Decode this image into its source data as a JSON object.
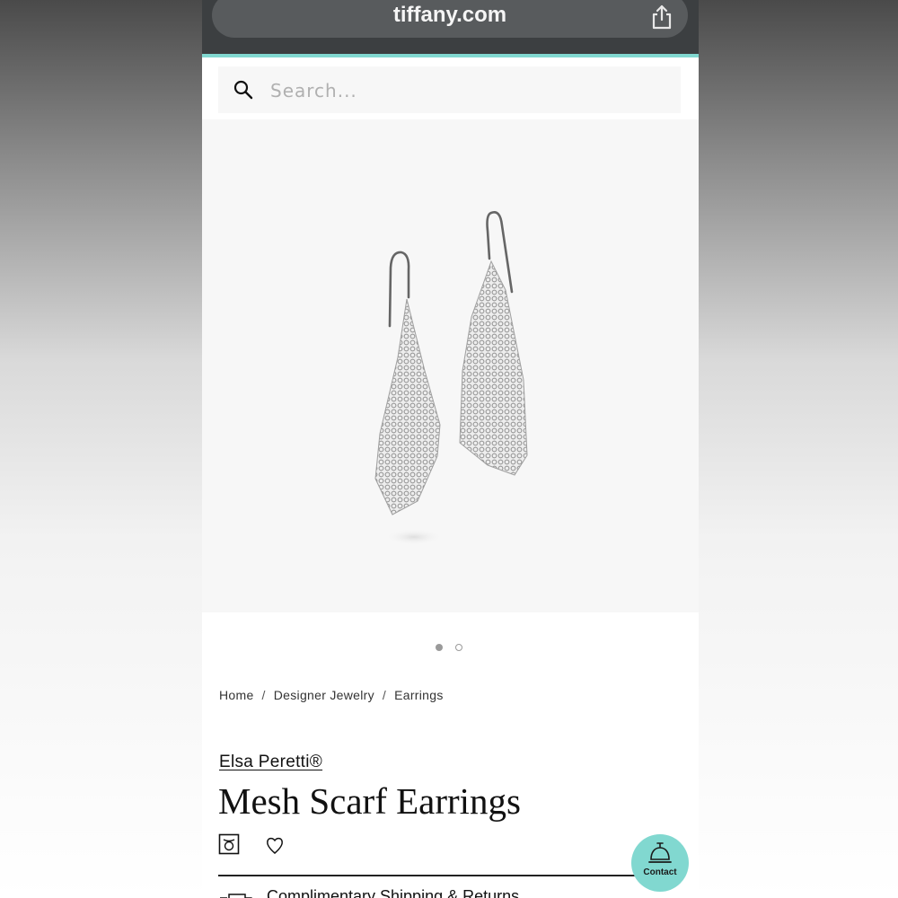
{
  "browser": {
    "url": "tiffany.com"
  },
  "search": {
    "placeholder": "Search..."
  },
  "carousel": {
    "total_images": 2,
    "active_index": 1
  },
  "breadcrumb": {
    "items": [
      "Home",
      "Designer Jewelry",
      "Earrings"
    ],
    "separator": "/"
  },
  "product": {
    "brand": "Elsa Peretti®",
    "title": "Mesh Scarf Earrings",
    "icons": [
      "ring-box-icon",
      "heart-icon"
    ]
  },
  "shipping": {
    "label": "Complimentary Shipping & Returns"
  },
  "contact": {
    "label": "Contact"
  },
  "colors": {
    "tiffany_blue": "#81d8d0",
    "browser_chrome": "#3c3f41",
    "text": "#111111"
  }
}
